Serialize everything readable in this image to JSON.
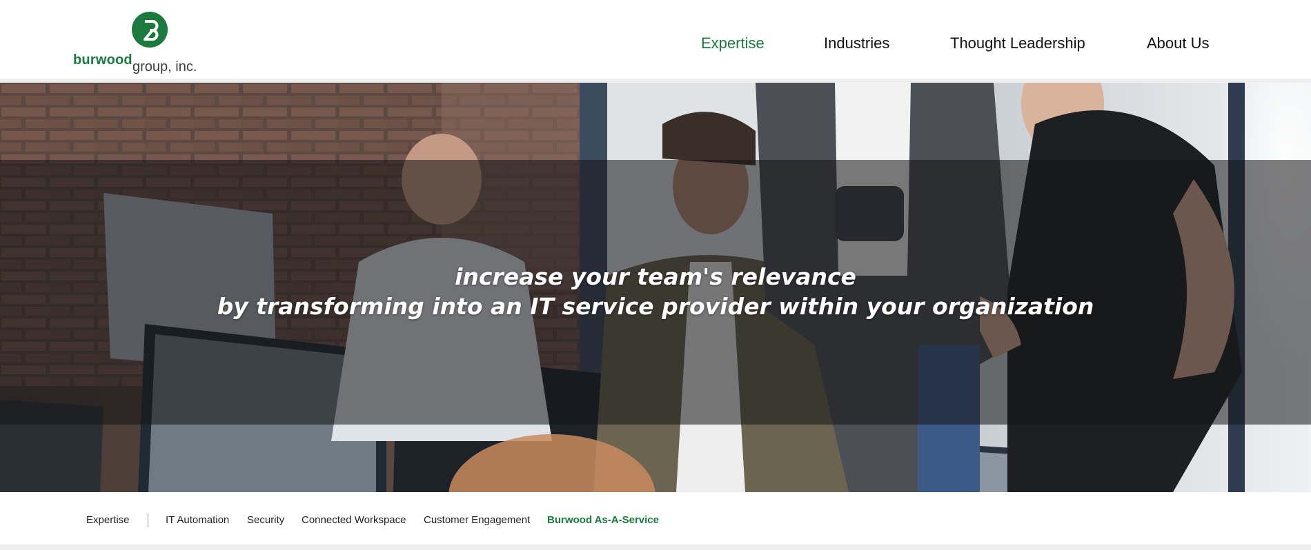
{
  "logo": {
    "mark_letter": "B",
    "wordmark_bold": "burwood",
    "wordmark_rest": "group, inc.",
    "brand_color": "#1b7a3e"
  },
  "nav": {
    "items": [
      {
        "label": "Expertise",
        "active": true
      },
      {
        "label": "Industries",
        "active": false
      },
      {
        "label": "Thought Leadership",
        "active": false
      },
      {
        "label": "About Us",
        "active": false
      }
    ]
  },
  "hero": {
    "line1": "increase your team's relevance",
    "line2": "by transforming into an IT service provider within your organization"
  },
  "subnav": {
    "root": "Expertise",
    "items": [
      {
        "label": "IT Automation",
        "active": false
      },
      {
        "label": "Security",
        "active": false
      },
      {
        "label": "Connected Workspace",
        "active": false
      },
      {
        "label": "Customer Engagement",
        "active": false
      },
      {
        "label": "Burwood As-A-Service",
        "active": true
      }
    ]
  },
  "colors": {
    "accent": "#1b7a3e",
    "text": "#111111",
    "hero_overlay": "#141416"
  }
}
